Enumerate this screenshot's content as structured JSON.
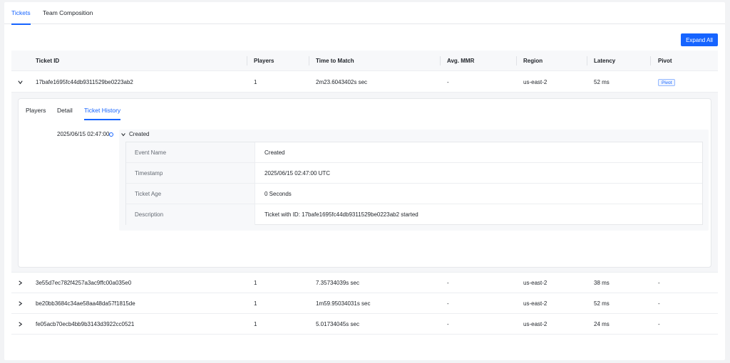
{
  "tabs": [
    {
      "label": "Tickets",
      "active": true
    },
    {
      "label": "Team Composition",
      "active": false
    }
  ],
  "expand_all_label": "Expand All",
  "table": {
    "columns": [
      "Ticket ID",
      "Players",
      "Time to Match",
      "Avg. MMR",
      "Region",
      "Latency",
      "Pivot"
    ],
    "rows": [
      {
        "ticket_id": "17bafe1695fc44db9311529be0223ab2",
        "players": "1",
        "time_to_match": "2m23.6043402s sec",
        "avg_mmr": "-",
        "region": "us-east-2",
        "latency": "52 ms",
        "pivot": "Pivot",
        "expanded": true
      },
      {
        "ticket_id": "3e55d7ec782f4257a3ac9ffc00a035e0",
        "players": "1",
        "time_to_match": "7.35734039s sec",
        "avg_mmr": "-",
        "region": "us-east-2",
        "latency": "38 ms",
        "pivot": "-",
        "expanded": false
      },
      {
        "ticket_id": "be20bb3684c34ae58aa48da57f1815de",
        "players": "1",
        "time_to_match": "1m59.95034031s sec",
        "avg_mmr": "-",
        "region": "us-east-2",
        "latency": "52 ms",
        "pivot": "-",
        "expanded": false
      },
      {
        "ticket_id": "fe05acb70ecb4bb9b3143d3922cc0521",
        "players": "1",
        "time_to_match": "5.01734045s sec",
        "avg_mmr": "-",
        "region": "us-east-2",
        "latency": "24 ms",
        "pivot": "-",
        "expanded": false
      }
    ]
  },
  "detail_panel": {
    "subtabs": [
      {
        "label": "Players",
        "active": false
      },
      {
        "label": "Detail",
        "active": false
      },
      {
        "label": "Ticket History",
        "active": true
      }
    ],
    "history": {
      "timestamp": "2025/06/15 02:47:00",
      "event_title": "Created",
      "fields": [
        {
          "label": "Event Name",
          "value": "Created"
        },
        {
          "label": "Timestamp",
          "value": "2025/06/15 02:47:00 UTC"
        },
        {
          "label": "Ticket Age",
          "value": "0 Seconds"
        },
        {
          "label": "Description",
          "value": "Ticket with ID: 17bafe1695fc44db9311529be0223ab2 started"
        }
      ]
    }
  },
  "colors": {
    "accent": "#1664ff"
  }
}
